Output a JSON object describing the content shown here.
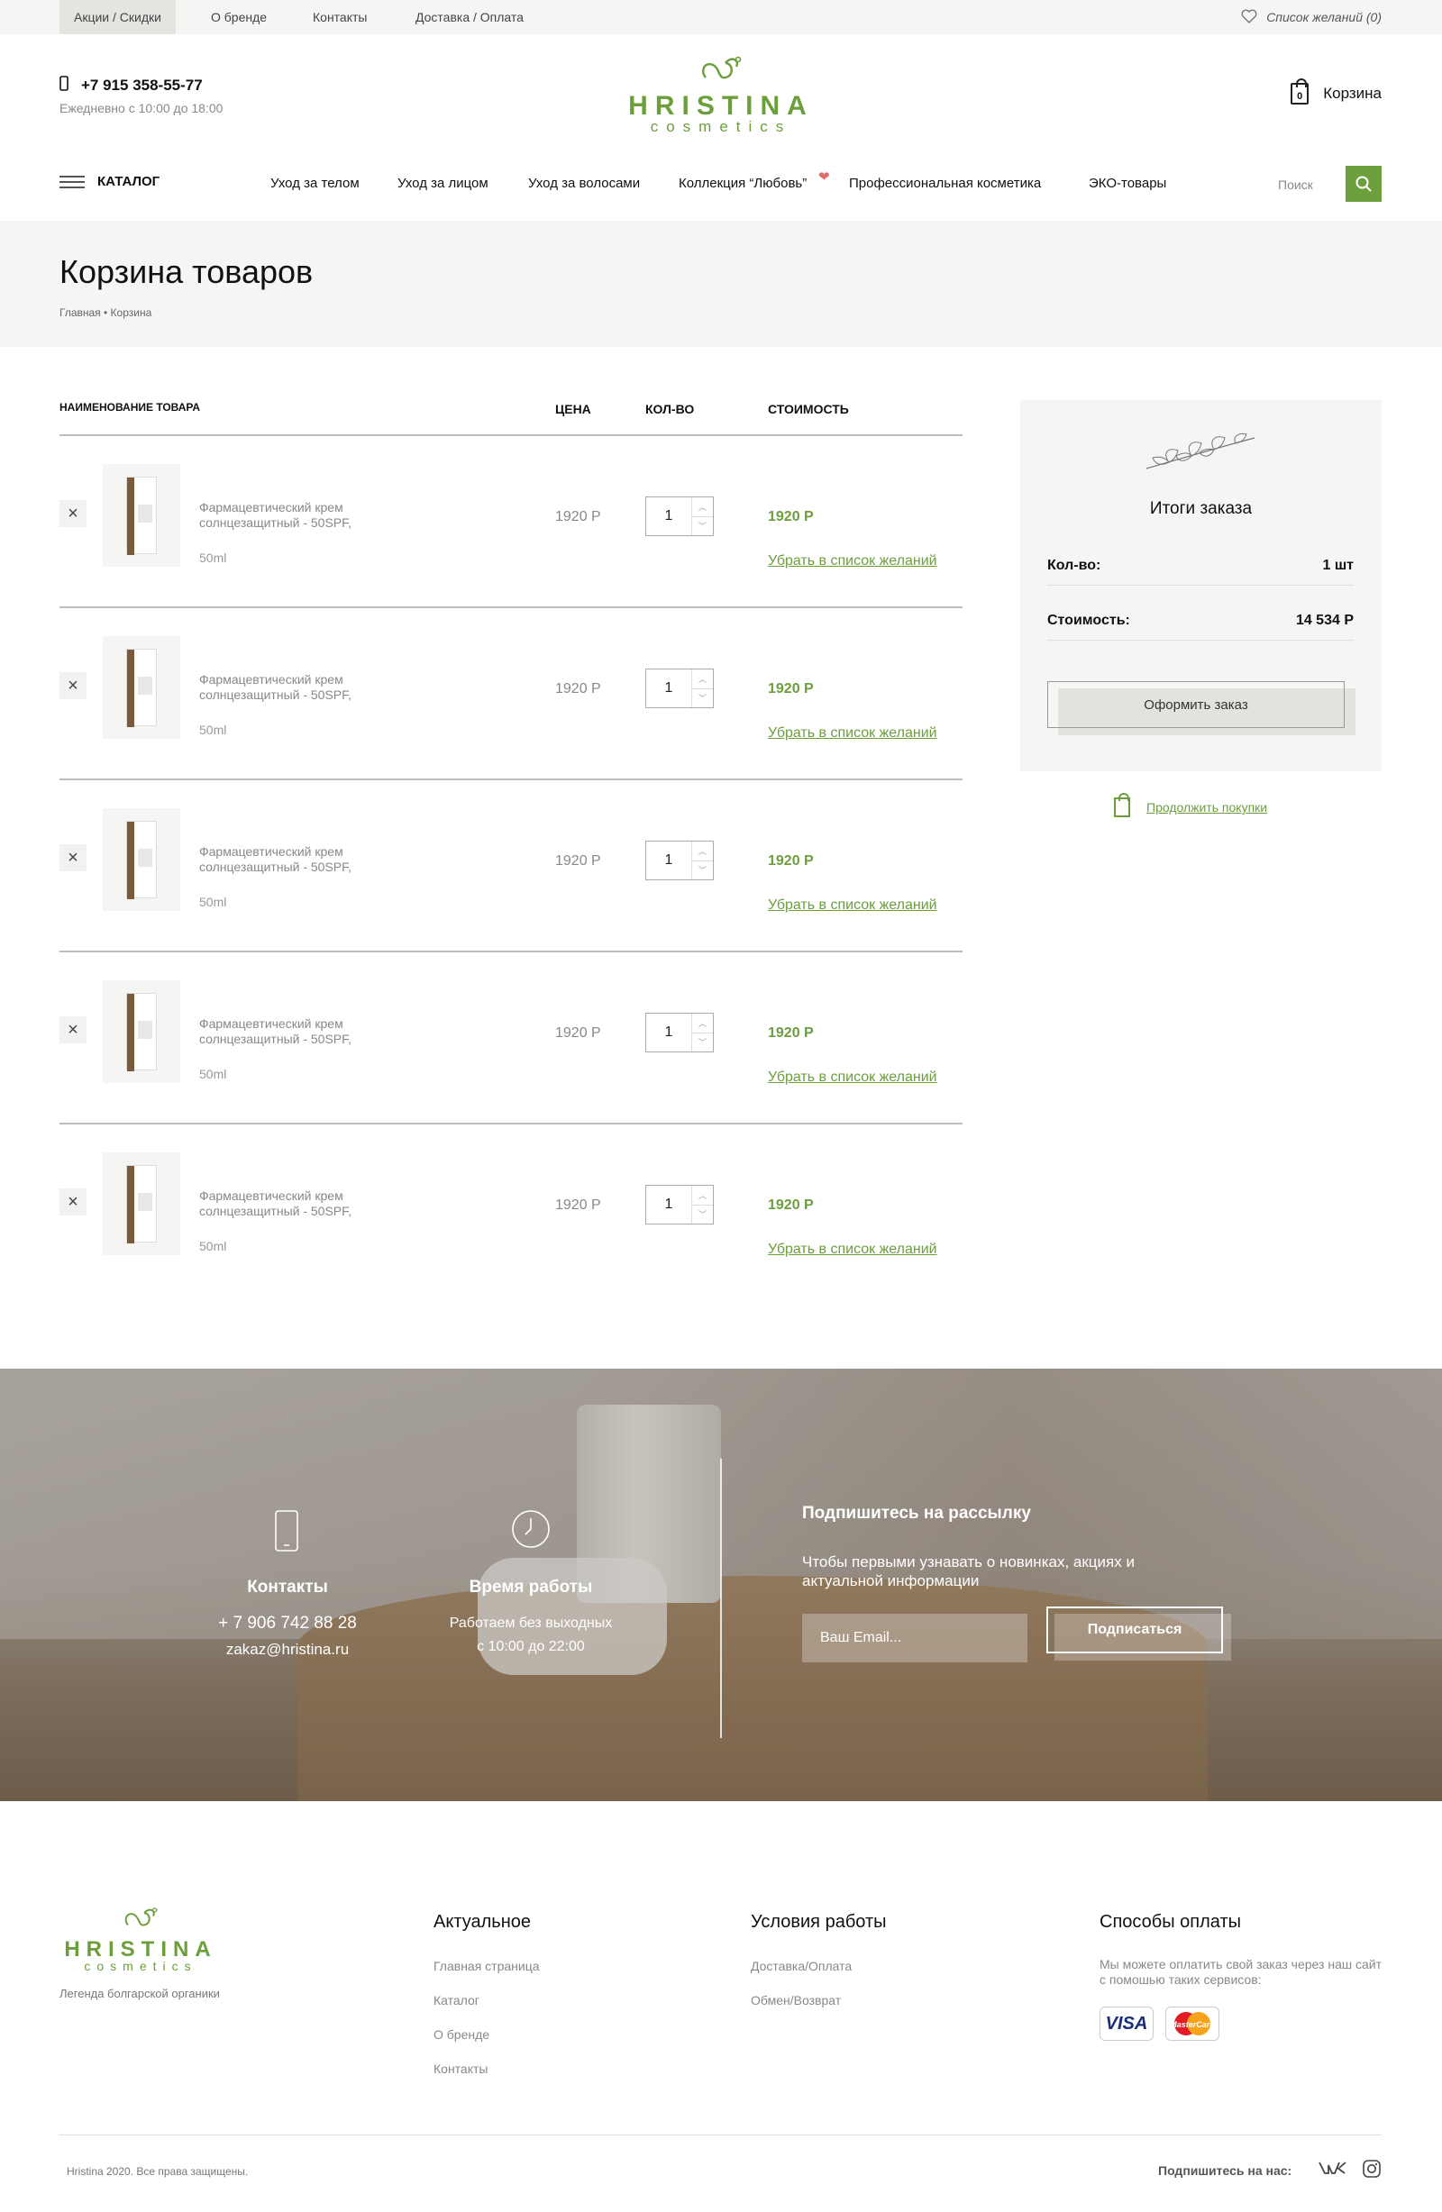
{
  "topbar": {
    "links": [
      "Акции / Скидки",
      "О бренде",
      "Контакты",
      "Доставка / Оплата"
    ],
    "wishlist": "Список желаний (0)"
  },
  "header": {
    "phone": "+7 915 358-55-77",
    "hours": "Ежедневно с 10:00 до 18:00",
    "logo_word": "HRISTINA",
    "logo_sub": "cosmetics",
    "cart_label": "Корзина",
    "cart_count": "0"
  },
  "nav": {
    "catalog": "КАТАЛОГ",
    "items": [
      "Уход за телом",
      "Уход за лицом",
      "Уход за волосами",
      "Коллекция “Любовь”",
      "Профессиональная косметика",
      "ЭКО-товары"
    ],
    "search_placeholder": "Поиск"
  },
  "page": {
    "title": "Корзина товаров",
    "breadcrumb": "Главная  •  Корзина"
  },
  "table": {
    "headers": {
      "name": "НАИМЕНОВАНИЕ ТОВАРА",
      "price": "ЦЕНА",
      "qty": "КОЛ-ВО",
      "cost": "СТОИМОСТЬ"
    },
    "rows": [
      {
        "name": "Фармацевтический крем солнцезащитный - 50SPF,",
        "volume": "50ml",
        "price": "1920 Р",
        "qty": "1",
        "cost": "1920 Р",
        "wish": "Убрать в список желаний"
      },
      {
        "name": "Фармацевтический крем солнцезащитный - 50SPF,",
        "volume": "50ml",
        "price": "1920 Р",
        "qty": "1",
        "cost": "1920 Р",
        "wish": "Убрать в список желаний"
      },
      {
        "name": "Фармацевтический крем солнцезащитный - 50SPF,",
        "volume": "50ml",
        "price": "1920 Р",
        "qty": "1",
        "cost": "1920 Р",
        "wish": "Убрать в список желаний"
      },
      {
        "name": "Фармацевтический крем солнцезащитный - 50SPF,",
        "volume": "50ml",
        "price": "1920 Р",
        "qty": "1",
        "cost": "1920 Р",
        "wish": "Убрать в список желаний"
      },
      {
        "name": "Фармацевтический крем солнцезащитный - 50SPF,",
        "volume": "50ml",
        "price": "1920 Р",
        "qty": "1",
        "cost": "1920 Р",
        "wish": "Убрать в список желаний"
      }
    ]
  },
  "summary": {
    "title": "Итоги заказа",
    "qty_label": "Кол-во:",
    "qty_value": "1 шт",
    "cost_label": "Стоимость:",
    "cost_value": "14 534 Р",
    "order_button": "Оформить заказ",
    "continue": "Продолжить покупки"
  },
  "banner": {
    "contacts_title": "Контакты",
    "contacts_phone": "+ 7 906 742 88 28",
    "contacts_email": "zakaz@hristina.ru",
    "hours_title": "Время работы",
    "hours_line1": "Работаем без выходных",
    "hours_line2": "с 10:00 до 22:00",
    "subscribe_title": "Подпишитесь на рассылку",
    "subscribe_desc": "Чтобы первыми узнавать о новинках, акциях и актуальной информации",
    "email_placeholder": "Ваш Email...",
    "subscribe_button": "Подписаться"
  },
  "footer": {
    "tagline": "Легенда болгарской органики",
    "col1_title": "Актуальное",
    "col1_links": [
      "Главная страница",
      "Каталог",
      "О бренде",
      "Контакты"
    ],
    "col2_title": "Условия работы",
    "col2_links": [
      "Доставка/Оплата",
      "Обмен/Возврат"
    ],
    "col3_title": "Способы оплаты",
    "pay_desc": "Мы можете оплатить свой заказ через наш сайт с помошью таких сервисов:",
    "card1": "VISA",
    "card2": "MasterCard",
    "copyright": "Hristina 2020. Все права защищены.",
    "follow": "Подпишитесь на нас:"
  },
  "colors": {
    "accent": "#6c9f3c",
    "hero_bg": "#f5f5f3",
    "heart": "#e06a6a"
  }
}
